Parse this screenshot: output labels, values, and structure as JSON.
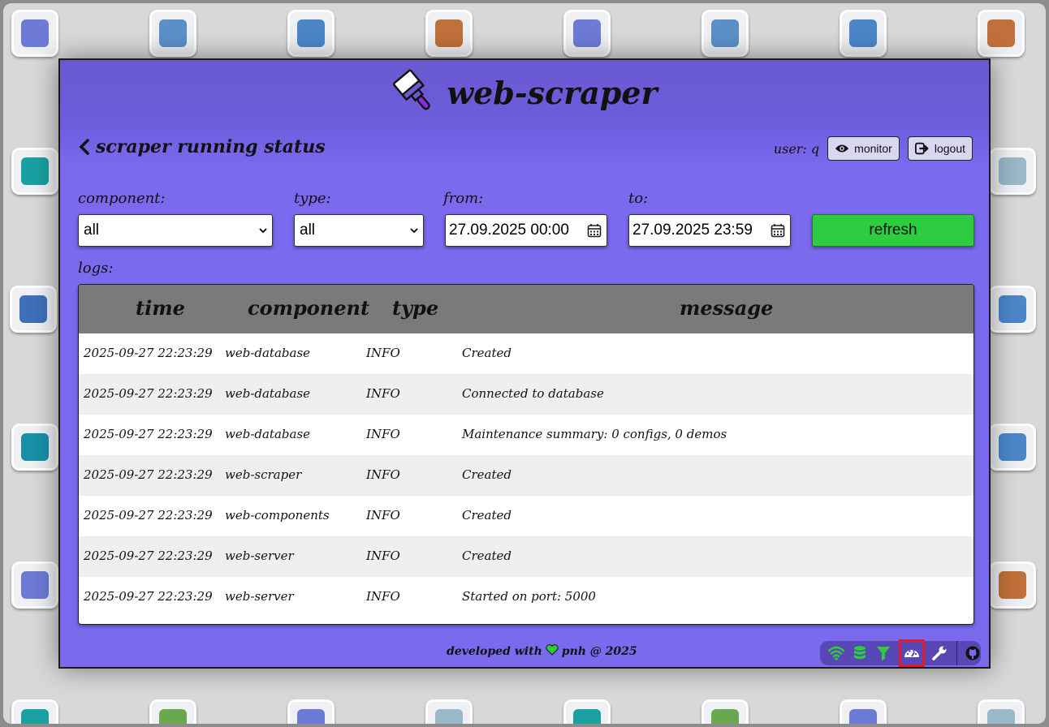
{
  "app": {
    "title": "web-scraper"
  },
  "page": {
    "title": "scraper running status"
  },
  "user": {
    "label": "user: q"
  },
  "buttons": {
    "monitor": "monitor",
    "logout": "logout",
    "refresh": "refresh"
  },
  "filters": {
    "component": {
      "label": "component:",
      "value": "all"
    },
    "type": {
      "label": "type:",
      "value": "all"
    },
    "from": {
      "label": "from:",
      "value": "27.09.2025 00:00"
    },
    "to": {
      "label": "to:",
      "value": "27.09.2025 23:59"
    }
  },
  "logs": {
    "label": "logs:",
    "columns": [
      "time",
      "component",
      "type",
      "message"
    ],
    "rows": [
      [
        "2025-09-27 22:23:29",
        "web-database",
        "INFO",
        "Created"
      ],
      [
        "2025-09-27 22:23:29",
        "web-database",
        "INFO",
        "Connected to database"
      ],
      [
        "2025-09-27 22:23:29",
        "web-database",
        "INFO",
        "Maintenance summary: 0 configs, 0 demos"
      ],
      [
        "2025-09-27 22:23:29",
        "web-scraper",
        "INFO",
        "Created"
      ],
      [
        "2025-09-27 22:23:29",
        "web-components",
        "INFO",
        "Created"
      ],
      [
        "2025-09-27 22:23:29",
        "web-server",
        "INFO",
        "Created"
      ],
      [
        "2025-09-27 22:23:29",
        "web-server",
        "INFO",
        "Started on port: 5000"
      ]
    ]
  },
  "footer": {
    "prefix": "developed with",
    "suffix": "pnh @ 2025"
  },
  "toolbar": {
    "icons": [
      "wifi-icon",
      "database-icon",
      "filter-icon",
      "dashboard-icon",
      "wrench-icon",
      "github-icon"
    ],
    "active": "dashboard-icon",
    "accent": "#2ecc40"
  },
  "colors": {
    "window_bg": "#7b6aee",
    "refresh_bg": "#2ecc40",
    "table_header": "#7a7a7a",
    "active_outline": "#e01b2a"
  }
}
